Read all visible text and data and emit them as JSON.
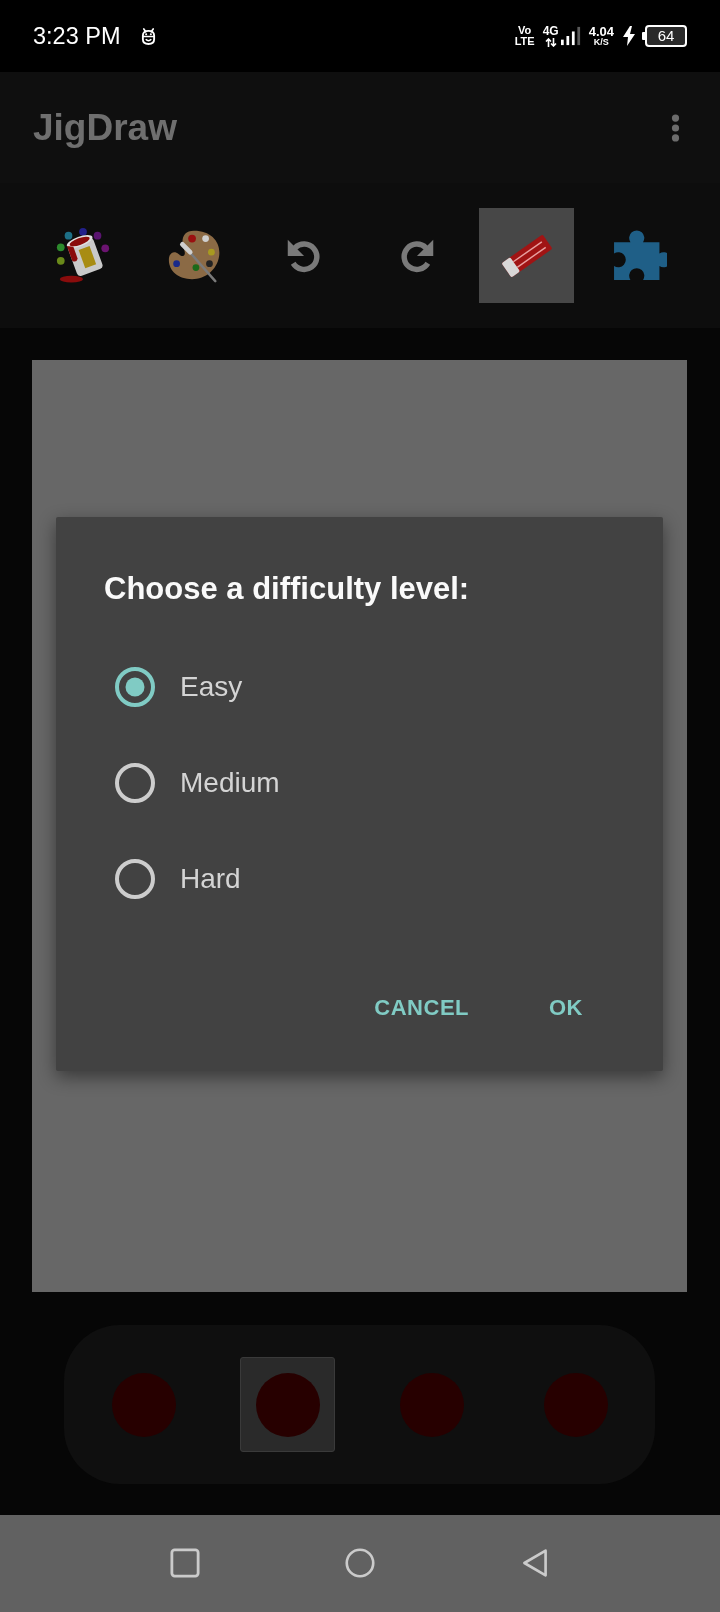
{
  "status_bar": {
    "time": "3:23 PM",
    "volte_top": "Vo",
    "volte_bottom": "LTE",
    "network": "4G",
    "speed": "4.04",
    "speed_unit": "K/S",
    "charging": true,
    "battery": "64"
  },
  "app_bar": {
    "title": "JigDraw"
  },
  "toolbar": {
    "tools": [
      {
        "kind": "fill",
        "selected": false
      },
      {
        "kind": "palette",
        "selected": false
      },
      {
        "kind": "undo",
        "selected": false
      },
      {
        "kind": "redo",
        "selected": false
      },
      {
        "kind": "eraser",
        "selected": true
      },
      {
        "kind": "puzzle",
        "selected": false
      }
    ]
  },
  "dialog": {
    "title": "Choose a difficulty level:",
    "options": [
      {
        "label": "Easy",
        "selected": true
      },
      {
        "label": "Medium",
        "selected": false
      },
      {
        "label": "Hard",
        "selected": false
      }
    ],
    "buttons": [
      "CANCEL",
      "OK"
    ]
  },
  "brushes": [
    {
      "selected": false
    },
    {
      "selected": true
    },
    {
      "selected": false
    },
    {
      "selected": false
    }
  ]
}
